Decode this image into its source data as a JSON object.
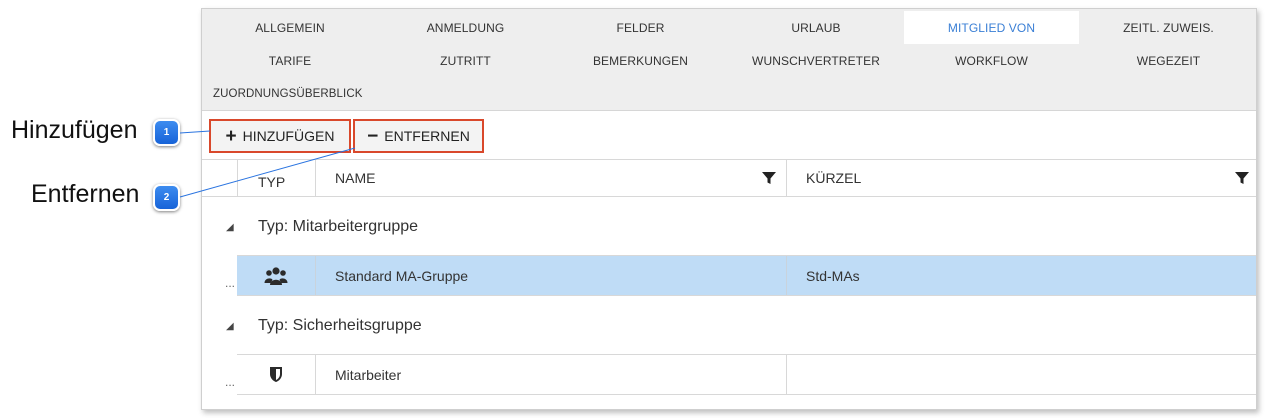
{
  "tabs": [
    {
      "label": "ALLGEMEIN",
      "active": false
    },
    {
      "label": "ANMELDUNG",
      "active": false
    },
    {
      "label": "FELDER",
      "active": false
    },
    {
      "label": "URLAUB",
      "active": false
    },
    {
      "label": "MITGLIED VON",
      "active": true
    },
    {
      "label": "ZEITL. ZUWEIS.",
      "active": false
    },
    {
      "label": "TARIFE",
      "active": false
    },
    {
      "label": "ZUTRITT",
      "active": false
    },
    {
      "label": "BEMERKUNGEN",
      "active": false
    },
    {
      "label": "WUNSCHVERTRETER",
      "active": false
    },
    {
      "label": "WORKFLOW",
      "active": false
    },
    {
      "label": "WEGEZEIT",
      "active": false
    },
    {
      "label": "ZUORDNUNGSÜBERBLICK",
      "active": false
    }
  ],
  "toolbar": {
    "add_label": "HINZUFÜGEN",
    "add_icon": "plus-icon",
    "remove_label": "ENTFERNEN",
    "remove_icon": "minus-icon"
  },
  "grid": {
    "columns": [
      "TYP",
      "NAME",
      "KÜRZEL"
    ],
    "groups": [
      {
        "label": "Typ: Mitarbeitergruppe",
        "rows": [
          {
            "icon": "users-group-icon",
            "name": "Standard MA-Gruppe",
            "short": "Std-MAs",
            "selected": true
          }
        ]
      },
      {
        "label": "Typ: Sicherheitsgruppe",
        "rows": [
          {
            "icon": "shield-icon",
            "name": "Mitarbeiter",
            "short": "",
            "selected": false
          }
        ]
      }
    ],
    "row_marker": "..."
  },
  "callouts": [
    {
      "number": "1",
      "label": "Hinzufügen"
    },
    {
      "number": "2",
      "label": "Entfernen"
    }
  ],
  "colors": {
    "active_tab_text": "#3a7fd5",
    "highlight_border": "#d9482b",
    "selected_row": "#bfdcf6",
    "marker": "#1f6fe0"
  }
}
